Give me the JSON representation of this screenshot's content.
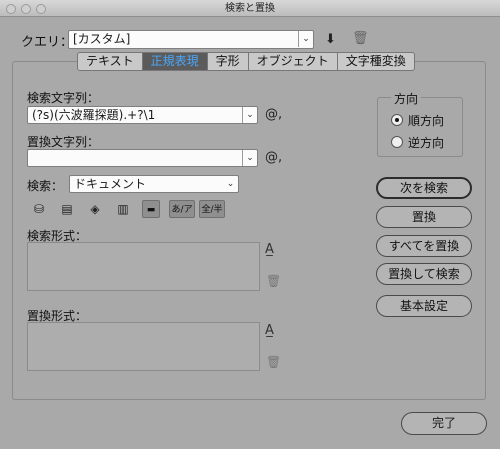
{
  "window": {
    "title": "検索と置換"
  },
  "query": {
    "label": "クエリ：",
    "value": "[カスタム]"
  },
  "tabs": [
    "テキスト",
    "正規表現",
    "字形",
    "オブジェクト",
    "文字種変換"
  ],
  "active_tab": "正規表現",
  "search": {
    "label": "検索文字列：",
    "value": "(?s)(六波羅探題).+?\\1",
    "special_char": "@,"
  },
  "replace": {
    "label": "置換文字列：",
    "value": "",
    "special_char": "@,"
  },
  "scope": {
    "label": "検索：",
    "value": "ドキュメント"
  },
  "toolbar": {
    "kana_label": "あ/ア",
    "width_label": "全/半"
  },
  "search_format": {
    "label": "検索形式："
  },
  "replace_format": {
    "label": "置換形式："
  },
  "direction": {
    "label": "方向",
    "forward": "順方向",
    "backward": "逆方向"
  },
  "buttons": {
    "find_next": "次を検索",
    "replace": "置換",
    "replace_all": "すべてを置換",
    "replace_find": "置換して検索",
    "basic": "基本設定",
    "done": "完了"
  }
}
